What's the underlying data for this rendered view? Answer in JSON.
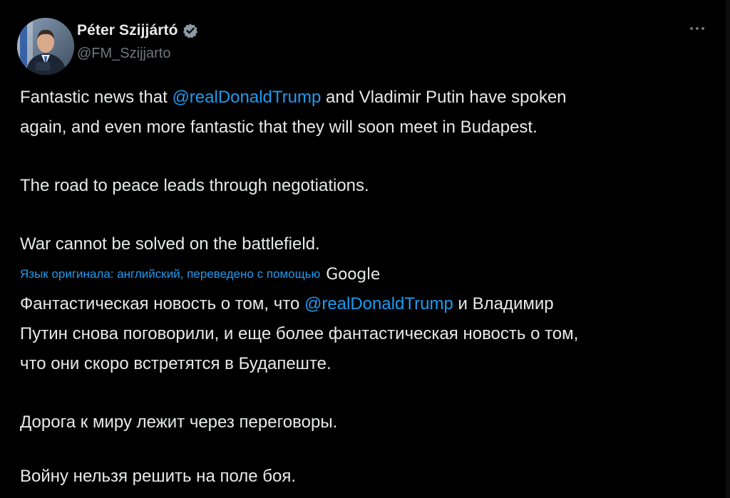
{
  "author": {
    "display_name": "Péter Szijjártó",
    "handle": "@FM_Szijjarto",
    "verified": true,
    "avatar_icon": "profile-photo-avatar"
  },
  "menu": {
    "icon": "more-horizontal-icon"
  },
  "original": {
    "p1_before": "Fantastic news that ",
    "p1_mention": "@realDonaldTrump",
    "p1_after_line1": " and Vladimir Putin have spoken",
    "p1_line2": "again, and even more fantastic that they will soon meet in Budapest.",
    "p2": "The road to peace leads through negotiations.",
    "p3": "War cannot be solved on the battlefield."
  },
  "translation_note": {
    "label": "Язык оригинала: английский, переведено с помощью",
    "provider": "Google"
  },
  "translated": {
    "p1_before": "Фантастическая новость о том, что ",
    "p1_mention": "@realDonaldTrump",
    "p1_after_line1": " и Владимир",
    "p1_line2": "Путин снова поговорили, и еще более фантастическая новость о том,",
    "p1_line3": "что они скоро встретятся в Будапеште.",
    "p2": "Дорога к миру лежит через переговоры.",
    "p3": "Войну нельзя решить на поле боя."
  },
  "colors": {
    "background": "#000000",
    "text": "#e7e9ea",
    "secondary": "#71767b",
    "link": "#1d9bf0"
  }
}
